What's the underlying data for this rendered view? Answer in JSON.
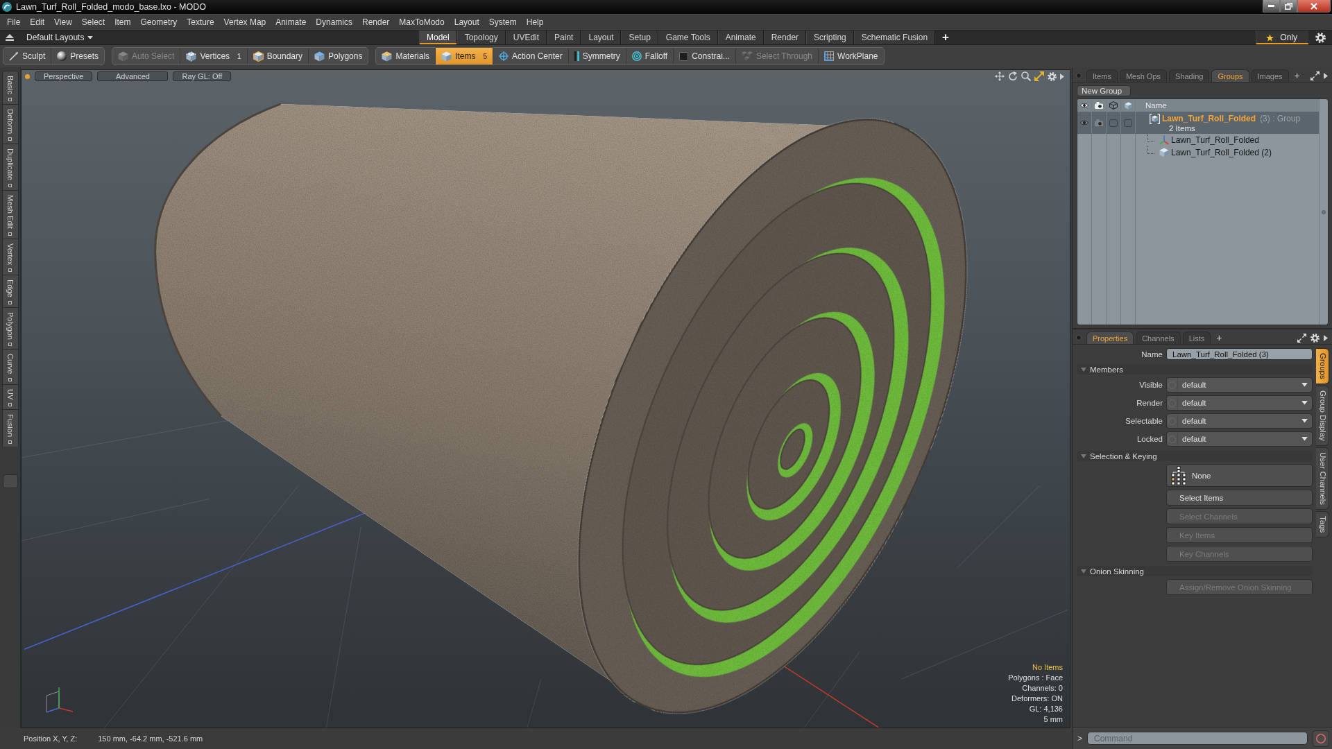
{
  "window": {
    "title": "Lawn_Turf_Roll_Folded_modo_base.lxo - MODO"
  },
  "menu_bar": [
    "File",
    "Edit",
    "View",
    "Select",
    "Item",
    "Geometry",
    "Texture",
    "Vertex Map",
    "Animate",
    "Dynamics",
    "Render",
    "MaxToModo",
    "Layout",
    "System",
    "Help"
  ],
  "layout_bar": {
    "layouts_menu": "Default Layouts",
    "tabs": [
      {
        "label": "Model",
        "selected": true
      },
      {
        "label": "Topology",
        "selected": false
      },
      {
        "label": "UVEdit",
        "selected": false
      },
      {
        "label": "Paint",
        "selected": false
      },
      {
        "label": "Layout",
        "selected": false
      },
      {
        "label": "Setup",
        "selected": false
      },
      {
        "label": "Game Tools",
        "selected": false
      },
      {
        "label": "Animate",
        "selected": false
      },
      {
        "label": "Render",
        "selected": false
      },
      {
        "label": "Scripting",
        "selected": false
      },
      {
        "label": "Schematic Fusion",
        "selected": false
      }
    ],
    "add_tab": "+",
    "only_toggle": {
      "label": "Only",
      "on": true
    }
  },
  "toolbar": {
    "groups": [
      [
        {
          "label": "Sculpt",
          "selected": false,
          "disabled": false
        },
        {
          "label": "Presets",
          "selected": false,
          "disabled": false
        }
      ],
      [
        {
          "label": "Auto Select",
          "selected": false,
          "disabled": true
        },
        {
          "label": "Vertices",
          "count": "1",
          "selected": false,
          "disabled": false
        },
        {
          "label": "Boundary",
          "selected": false,
          "disabled": false
        },
        {
          "label": "Polygons",
          "selected": false,
          "disabled": false
        }
      ],
      [
        {
          "label": "Materials",
          "selected": false,
          "disabled": false
        },
        {
          "label": "Items",
          "count": "5",
          "selected": true,
          "disabled": false
        },
        {
          "label": "Action Center",
          "selected": false,
          "disabled": false
        },
        {
          "label": "Symmetry",
          "selected": false,
          "disabled": false
        },
        {
          "label": "Falloff",
          "selected": false,
          "disabled": false
        },
        {
          "label": "Constrai...",
          "selected": false,
          "disabled": false
        },
        {
          "label": "Select Through",
          "selected": false,
          "disabled": true
        },
        {
          "label": "WorkPlane",
          "selected": false,
          "disabled": false
        }
      ]
    ]
  },
  "left_tabs": [
    {
      "label": "Basic",
      "selected": false
    },
    {
      "label": "Deform",
      "selected": false
    },
    {
      "label": "Duplicate",
      "selected": false
    },
    {
      "label": "Mesh Edit",
      "selected": false
    },
    {
      "label": "Vertex",
      "selected": false
    },
    {
      "label": "Edge",
      "selected": false
    },
    {
      "label": "Polygon",
      "selected": false
    },
    {
      "label": "Curve",
      "selected": false
    },
    {
      "label": "UV",
      "selected": false
    },
    {
      "label": "Fusion",
      "selected": false
    }
  ],
  "viewport": {
    "view_buttons": [
      "Perspective",
      "Advanced",
      "Ray GL: Off"
    ],
    "info": [
      {
        "text": "No Items",
        "highlighted": true
      },
      {
        "text": "Polygons : Face",
        "highlighted": false
      },
      {
        "text": "Channels: 0",
        "highlighted": false
      },
      {
        "text": "Deformers: ON",
        "highlighted": false
      },
      {
        "text": "GL: 4,136",
        "highlighted": false
      },
      {
        "text": "5 mm",
        "highlighted": false
      }
    ]
  },
  "status_bar": {
    "label": "Position X, Y, Z:",
    "value": "150 mm, -64.2 mm, -521.6 mm"
  },
  "groups_panel": {
    "tabs": [
      {
        "label": "Items",
        "selected": false
      },
      {
        "label": "Mesh Ops",
        "selected": false
      },
      {
        "label": "Shading",
        "selected": false
      },
      {
        "label": "Groups",
        "selected": true
      },
      {
        "label": "Images",
        "selected": false
      }
    ],
    "add_tab": "+",
    "new_group_button": "New Group",
    "name_column": "Name",
    "groups": [
      {
        "name": "Lawn_Turf_Roll_Folded",
        "suffix": "(3) : Group",
        "subtitle": "2 Items",
        "selected": true,
        "toggles": [
          {
            "on": true
          },
          {
            "on": true
          },
          {
            "on": false
          },
          {
            "on": false
          }
        ],
        "children": [
          {
            "name": "Lawn_Turf_Roll_Folded",
            "kind": "locator"
          },
          {
            "name": "Lawn_Turf_Roll_Folded (2)",
            "kind": "mesh"
          }
        ]
      }
    ]
  },
  "properties_panel": {
    "tabs": [
      {
        "label": "Properties",
        "selected": true
      },
      {
        "label": "Channels",
        "selected": false
      },
      {
        "label": "Lists",
        "selected": false
      }
    ],
    "add_tab": "+",
    "name_field": {
      "label": "Name",
      "value": "Lawn_Turf_Roll_Folded (3)"
    },
    "sections": [
      {
        "title": "Members",
        "expanded": true,
        "rows": [
          {
            "kind": "dropdown",
            "label": "Visible",
            "value": "default"
          },
          {
            "kind": "dropdown",
            "label": "Render",
            "value": "default"
          },
          {
            "kind": "dropdown",
            "label": "Selectable",
            "value": "default"
          },
          {
            "kind": "dropdown",
            "label": "Locked",
            "value": "default"
          }
        ]
      },
      {
        "title": "Selection & Keying",
        "expanded": true,
        "rows": [
          {
            "kind": "icon_button",
            "label": "None",
            "disabled": false
          },
          {
            "kind": "button",
            "label": "Select Items",
            "disabled": false
          },
          {
            "kind": "button",
            "label": "Select Channels",
            "disabled": true
          },
          {
            "kind": "button",
            "label": "Key Items",
            "disabled": true
          },
          {
            "kind": "button",
            "label": "Key Channels",
            "disabled": true
          }
        ]
      },
      {
        "title": "Onion Skinning",
        "expanded": true,
        "rows": [
          {
            "kind": "button",
            "label": "Assign/Remove Onion Skinning",
            "disabled": true
          }
        ]
      }
    ],
    "side_tabs": [
      {
        "label": "Groups",
        "selected": true
      },
      {
        "label": "Group Display",
        "selected": false
      },
      {
        "label": "User Channels",
        "selected": false
      },
      {
        "label": "Tags",
        "selected": false
      }
    ]
  },
  "command_bar": {
    "prompt": ">",
    "placeholder": "Command"
  }
}
